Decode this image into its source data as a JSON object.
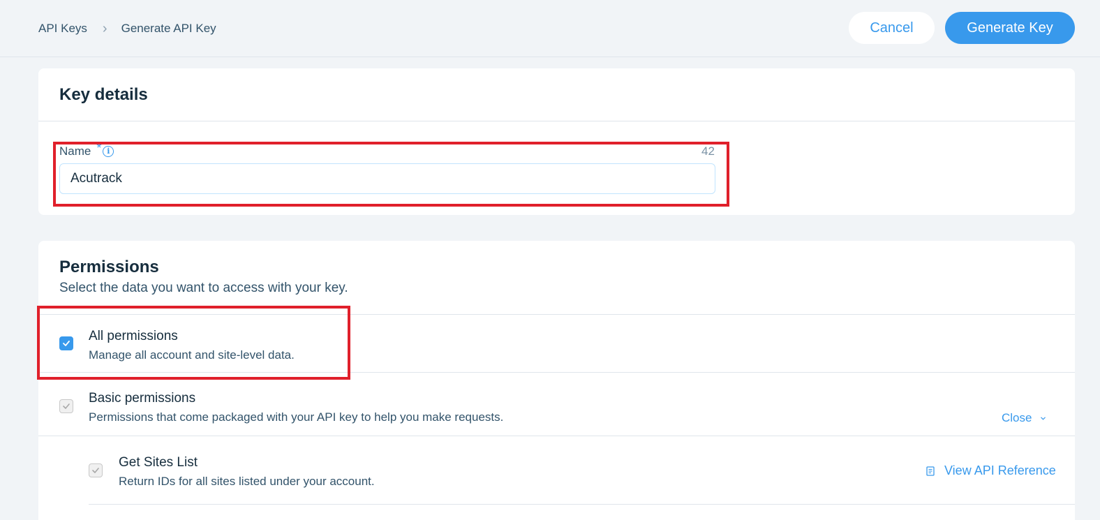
{
  "breadcrumb": {
    "root": "API Keys",
    "current": "Generate API Key"
  },
  "header": {
    "cancel_label": "Cancel",
    "generate_label": "Generate Key"
  },
  "key_details": {
    "title": "Key details",
    "name_label": "Name",
    "required_mark": "*",
    "char_count": "42",
    "name_value": "Acutrack"
  },
  "permissions": {
    "title": "Permissions",
    "subtitle": "Select the data you want to access with your key.",
    "all": {
      "name": "All permissions",
      "description": "Manage all account and site-level data."
    },
    "basic": {
      "name": "Basic permissions",
      "description": "Permissions that come packaged with your API key to help you make requests.",
      "toggle_label": "Close"
    },
    "sites_list": {
      "name": "Get Sites List",
      "description": "Return IDs for all sites listed under your account.",
      "reference_label": "View API Reference"
    }
  },
  "colors": {
    "accent": "#3899ec",
    "highlight": "#e0202b"
  }
}
